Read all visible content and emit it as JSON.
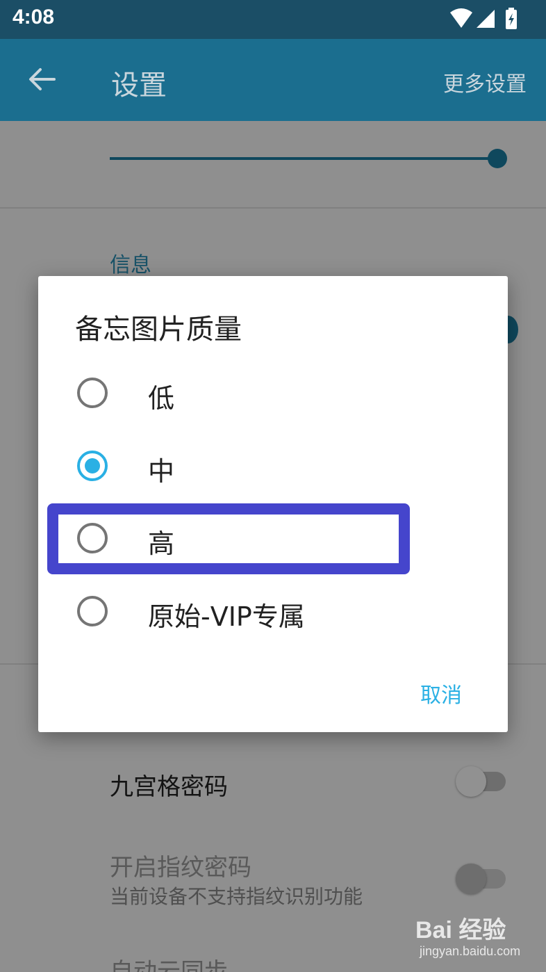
{
  "status_bar": {
    "time": "4:08"
  },
  "app_bar": {
    "title": "设置",
    "more_label": "更多设置"
  },
  "settings": {
    "section_title": "信息",
    "rows": [
      {
        "label": "九宫格密码"
      },
      {
        "label": "开启指纹密码",
        "subtitle": "当前设备不支持指纹识别功能"
      },
      {
        "label": "自动云同步"
      }
    ]
  },
  "dialog": {
    "title": "备忘图片质量",
    "options": [
      {
        "label": "低",
        "selected": false
      },
      {
        "label": "中",
        "selected": true
      },
      {
        "label": "高",
        "selected": false
      },
      {
        "label": "原始-VIP专属",
        "selected": false
      }
    ],
    "cancel_label": "取消"
  },
  "watermark": {
    "brand": "Bai 经验",
    "url": "jingyan.baidu.com"
  },
  "colors": {
    "accent": "#2ab0e4",
    "app_bar": "#1b6e8f",
    "status_bar": "#1b4e66",
    "highlight": "#4545cc"
  }
}
